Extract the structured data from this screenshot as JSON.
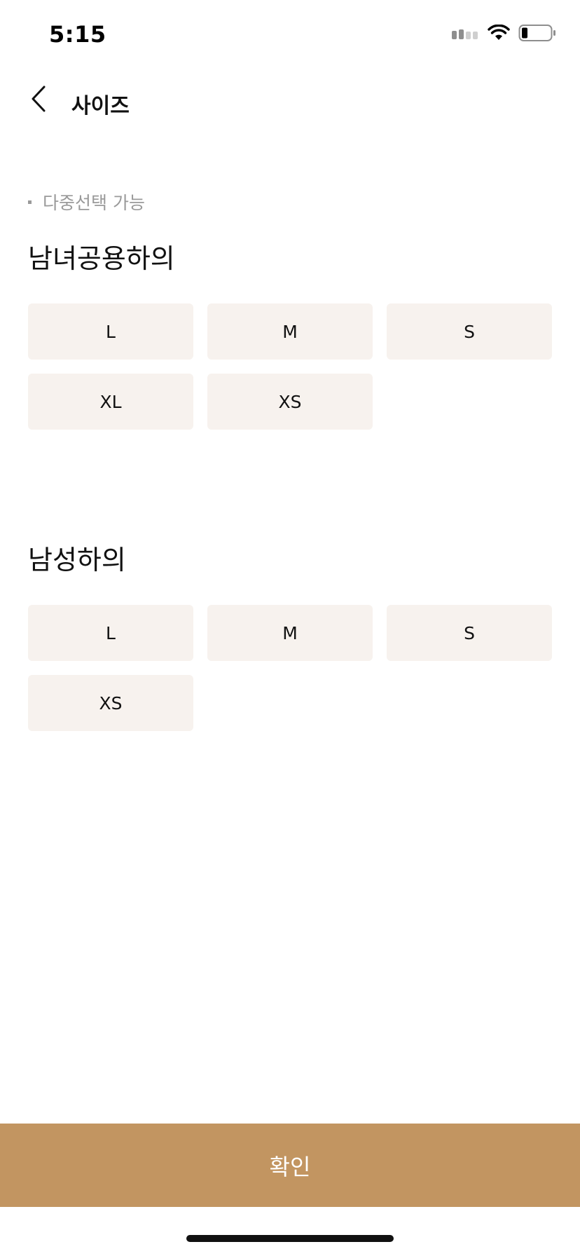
{
  "status_bar": {
    "time": "5:15",
    "signal_icon": "cellular-signal-icon",
    "wifi_icon": "wifi-icon",
    "battery_icon": "battery-icon"
  },
  "nav": {
    "back_icon": "chevron-left-icon",
    "title": "사이즈"
  },
  "hint": "다중선택 가능",
  "sections": [
    {
      "title": "남녀공용하의",
      "sizes": [
        "L",
        "M",
        "S",
        "XL",
        "XS"
      ]
    },
    {
      "title": "남성하의",
      "sizes": [
        "L",
        "M",
        "S",
        "XS"
      ]
    }
  ],
  "confirm_label": "확인",
  "colors": {
    "accent": "#c29561",
    "chip_bg": "#f7f2ee",
    "hint_text": "#9a9a9a"
  }
}
